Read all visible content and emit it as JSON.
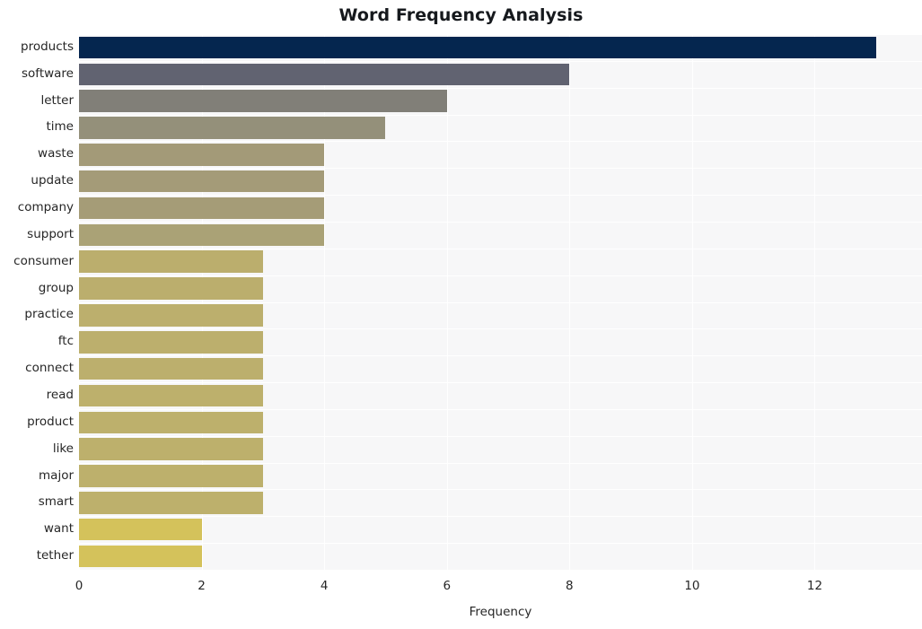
{
  "chart_data": {
    "type": "bar",
    "orientation": "horizontal",
    "title": "Word Frequency Analysis",
    "xlabel": "Frequency",
    "ylabel": "",
    "categories": [
      "products",
      "software",
      "letter",
      "time",
      "waste",
      "update",
      "company",
      "support",
      "consumer",
      "group",
      "practice",
      "ftc",
      "connect",
      "read",
      "product",
      "like",
      "major",
      "smart",
      "want",
      "tether"
    ],
    "values": [
      13,
      8,
      6,
      5,
      4,
      4,
      4,
      4,
      3,
      3,
      3,
      3,
      3,
      3,
      3,
      3,
      3,
      3,
      2,
      2
    ],
    "bar_colors": [
      "#05264f",
      "#616371",
      "#817f78",
      "#94907a",
      "#a39a78",
      "#a49b78",
      "#a59c77",
      "#aaa276",
      "#bbae6d",
      "#bbae6d",
      "#bcaf6d",
      "#bcaf6d",
      "#bcaf6d",
      "#bdb06c",
      "#bdb06c",
      "#bdb06c",
      "#bdb06c",
      "#bdb06c",
      "#d4c25b",
      "#d4c25b"
    ],
    "xticks": [
      0,
      2,
      4,
      6,
      8,
      10,
      12
    ],
    "xtick_labels": [
      "0",
      "2",
      "4",
      "6",
      "8",
      "10",
      "12"
    ],
    "xlim": [
      0,
      13.75
    ],
    "grid": true,
    "grid_color": "#ffffff",
    "plot_background": "#f7f7f8",
    "figure_background": "#ffffff",
    "legend": null
  }
}
